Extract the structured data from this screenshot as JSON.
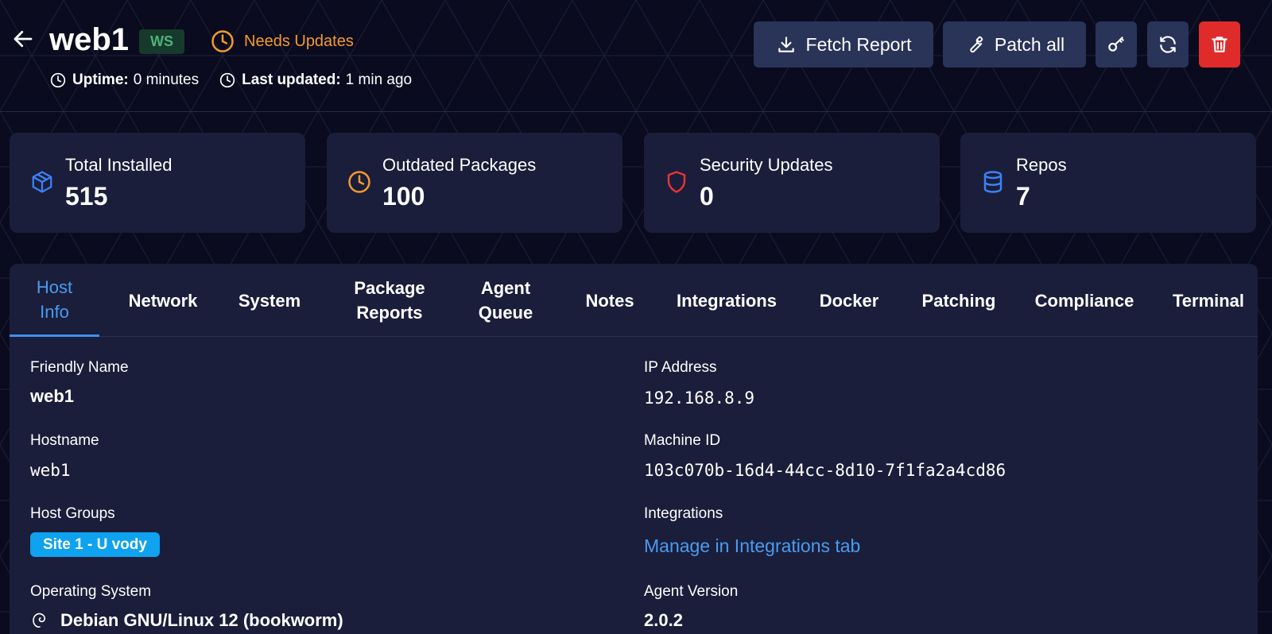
{
  "header": {
    "title": "web1",
    "badge": "WS",
    "status": "Needs Updates",
    "uptime_label": "Uptime:",
    "uptime_value": "0 minutes",
    "updated_label": "Last updated:",
    "updated_value": "1 min ago"
  },
  "actions": {
    "fetch_report": "Fetch Report",
    "patch_all": "Patch all"
  },
  "stats": [
    {
      "label": "Total Installed",
      "value": "515",
      "icon": "box-icon",
      "color": "#3b82f6"
    },
    {
      "label": "Outdated Packages",
      "value": "100",
      "icon": "clock-icon",
      "color": "#f59a2c"
    },
    {
      "label": "Security Updates",
      "value": "0",
      "icon": "shield-icon",
      "color": "#e53535"
    },
    {
      "label": "Repos",
      "value": "7",
      "icon": "database-icon",
      "color": "#3b82f6"
    }
  ],
  "tabs": [
    {
      "label": "Host\nInfo",
      "active": true
    },
    {
      "label": "Network"
    },
    {
      "label": "System"
    },
    {
      "label": "Package\nReports"
    },
    {
      "label": "Agent\nQueue"
    },
    {
      "label": "Notes"
    },
    {
      "label": "Integrations"
    },
    {
      "label": "Docker"
    },
    {
      "label": "Patching"
    },
    {
      "label": "Compliance"
    },
    {
      "label": "Terminal"
    }
  ],
  "host_info": {
    "friendly_name_label": "Friendly Name",
    "friendly_name": "web1",
    "hostname_label": "Hostname",
    "hostname": "web1",
    "host_groups_label": "Host Groups",
    "host_group": "Site 1 - U vody",
    "os_label": "Operating System",
    "os": "Debian GNU/Linux 12 (bookworm)",
    "ip_label": "IP Address",
    "ip": "192.168.8.9",
    "machine_id_label": "Machine ID",
    "machine_id": "103c070b-16d4-44cc-8d10-7f1fa2a4cd86",
    "integrations_label": "Integrations",
    "integrations_link": "Manage in Integrations tab",
    "agent_version_label": "Agent Version",
    "agent_version": "2.0.2"
  },
  "colors": {
    "background": "#0a0b1f",
    "card": "#1a1e3a",
    "accent": "#4a9bf0",
    "warning": "#f59a2c",
    "danger": "#e02b2b",
    "badge_green": "#4fb27a"
  }
}
